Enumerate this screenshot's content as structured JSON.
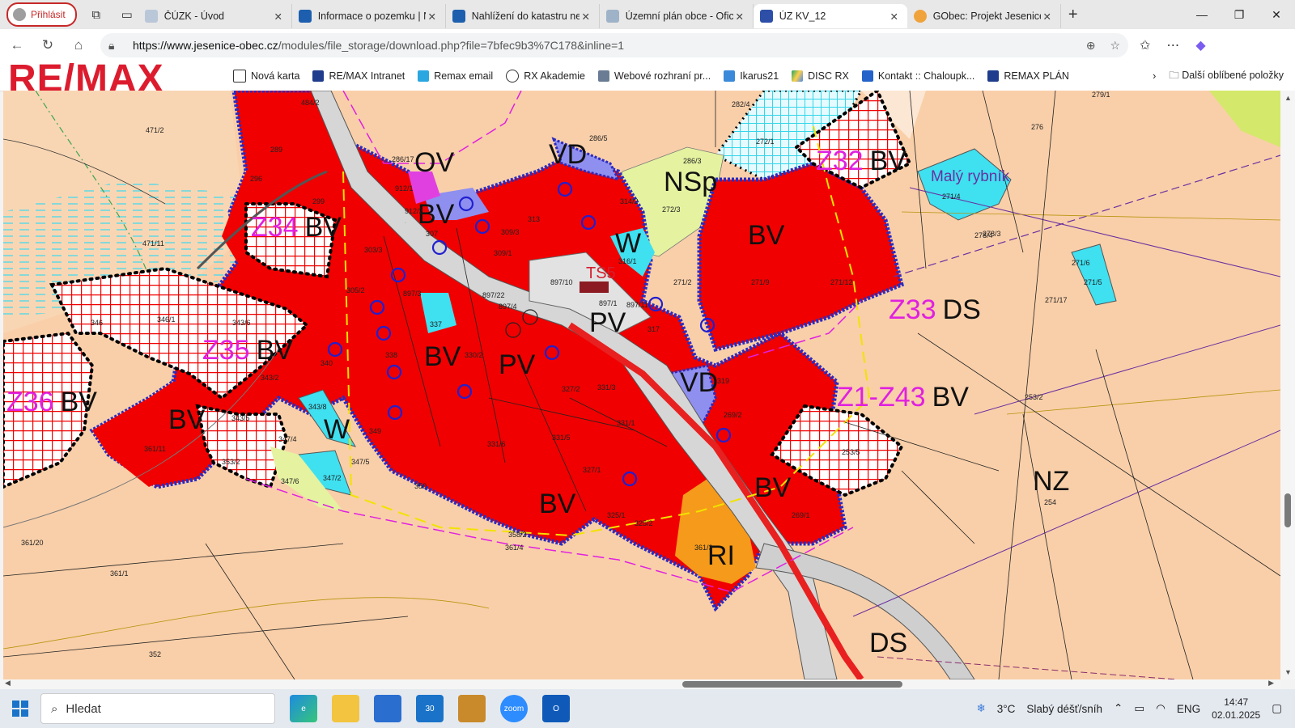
{
  "browser": {
    "profile_label": "Přihlásit",
    "tabs": [
      {
        "title": "ČÚZK - Úvod",
        "active": false
      },
      {
        "title": "Informace o pozemku | Nahlížení do katastru",
        "active": false
      },
      {
        "title": "Nahlížení do katastru nemovitostí",
        "active": false
      },
      {
        "title": "Územní plán obce - Oficiální stránky",
        "active": false
      },
      {
        "title": "ÚZ KV_12",
        "active": true
      },
      {
        "title": "GObec: Projekt Jesenice",
        "active": false
      }
    ],
    "url_host": "https://www.jesenice-obec.cz",
    "url_path": "/modules/file_storage/download.php?file=7bfec9b3%7C178&inline=1"
  },
  "favorites": {
    "logo_text": "RE/MAX",
    "items": [
      "Nová karta",
      "RE/MAX Intranet",
      "Remax email",
      "RX Akademie",
      "Webové rozhraní pr...",
      "Ikarus21",
      "DISC RX",
      "Kontakt :: Chaloupk...",
      "REMAX PLÁN"
    ],
    "other_label": "Další oblíbené položky"
  },
  "map": {
    "zone_labels": [
      {
        "text": "BV",
        "color": "#111"
      },
      {
        "text": "BV",
        "color": "#111"
      },
      {
        "text": "BV",
        "color": "#111"
      },
      {
        "text": "BV",
        "color": "#111"
      },
      {
        "text": "BV",
        "color": "#111"
      },
      {
        "text": "BV",
        "color": "#111"
      },
      {
        "text": "PV",
        "color": "#111"
      },
      {
        "text": "PV",
        "color": "#111"
      },
      {
        "text": "VD",
        "color": "#111"
      },
      {
        "text": "VD",
        "color": "#111"
      },
      {
        "text": "VD",
        "color": "#111"
      },
      {
        "text": "OV",
        "color": "#111"
      },
      {
        "text": "NSp",
        "color": "#111"
      },
      {
        "text": "W",
        "color": "#111"
      },
      {
        "text": "W",
        "color": "#111"
      },
      {
        "text": "NZ",
        "color": "#111"
      },
      {
        "text": "DS",
        "color": "#111"
      },
      {
        "text": "RI",
        "color": "#111"
      },
      {
        "text": "TS5",
        "color": "#d3202f"
      }
    ],
    "plan_labels": [
      {
        "zone": "Z32",
        "use": "BV"
      },
      {
        "zone": "Z33",
        "use": "DS"
      },
      {
        "zone": "Z34",
        "use": "BV"
      },
      {
        "zone": "Z35",
        "use": "BV"
      },
      {
        "zone": "Z36",
        "use": "BV"
      },
      {
        "zone": "Z1-Z43",
        "use": "BV"
      }
    ],
    "pond_label": "Malý rybník",
    "parcel_numbers": [
      "279/1",
      "276",
      "278/3",
      "278/4",
      "271/6",
      "271/5",
      "271/17",
      "271/12",
      "271/9",
      "271/2",
      "272/3",
      "286/3",
      "286/5",
      "286/17",
      "282/4",
      "272/1",
      "314/2",
      "316/1",
      "897/10",
      "897/1",
      "897/11",
      "317",
      "319",
      "269/2",
      "253/2",
      "253/5",
      "254",
      "269/1",
      "361/3",
      "325/2",
      "325/1",
      "327/1",
      "331/5",
      "331/6",
      "331/1",
      "327/2",
      "331/3",
      "330/2",
      "337",
      "338",
      "340",
      "343/2",
      "343/8",
      "349",
      "347/4",
      "347/5",
      "347/6",
      "347/2",
      "350",
      "361/20",
      "361/1",
      "352",
      "361/11",
      "353/2",
      "343/5",
      "343/6",
      "346/1",
      "346",
      "471/11",
      "309/3",
      "309/1",
      "303/3",
      "305/2",
      "313",
      "299",
      "296",
      "289",
      "471/2",
      "484/2",
      "912/1",
      "912/2",
      "307",
      "897/3",
      "897/22",
      "897/4",
      "358/2",
      "361/4",
      "271/4"
    ]
  },
  "taskbar": {
    "search_placeholder": "Hledat",
    "weather_temp": "3°C",
    "weather_desc": "Slabý déšť/sníh",
    "lang": "ENG",
    "time": "14:47",
    "date": "02.01.2025"
  },
  "colors": {
    "accent_red": "#dc1c2e",
    "zone_red": "#f00000",
    "field": "#f9cfa9",
    "water": "#3fe0f0",
    "transport": "#d6d6d6",
    "blue_border": "#2b2bc0",
    "magenta": "#e020e0"
  }
}
